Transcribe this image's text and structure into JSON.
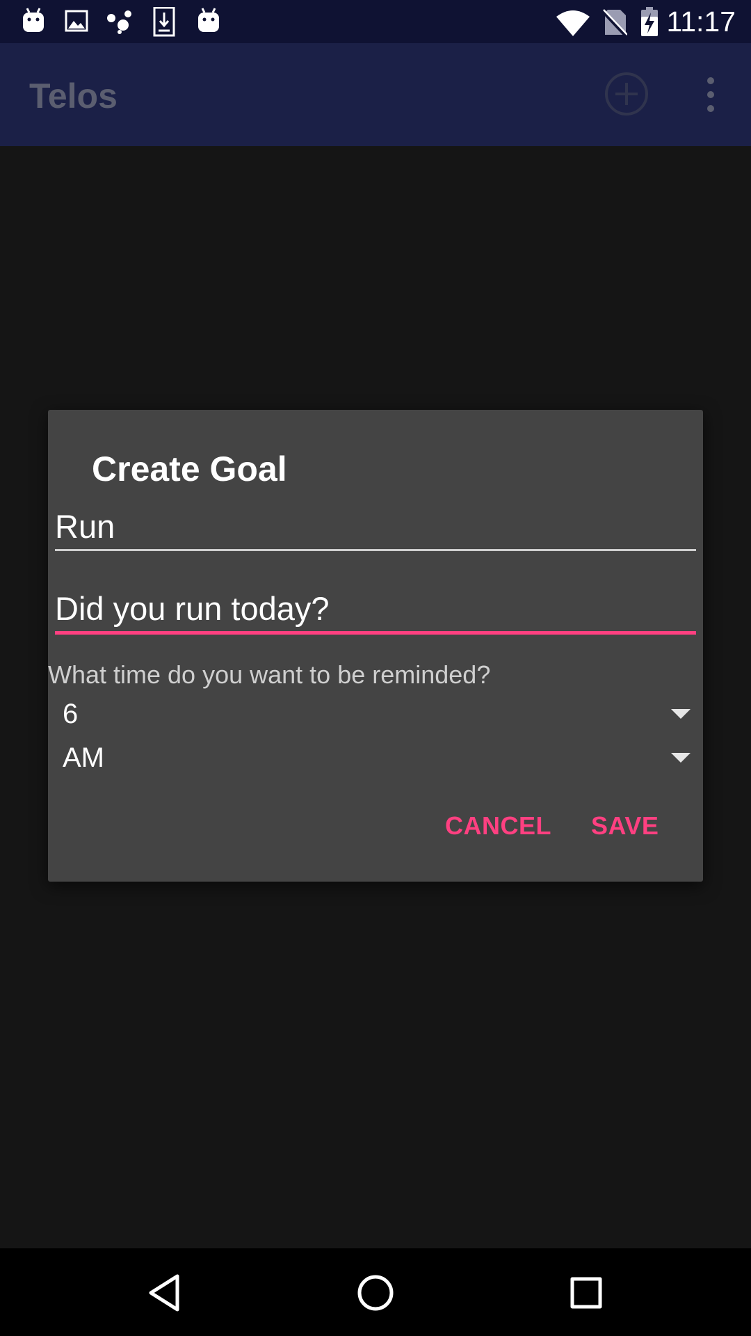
{
  "status_bar": {
    "time": "11:17",
    "icons": [
      "android-icon",
      "image-icon",
      "assistant-icon",
      "download-icon",
      "android-icon",
      "wifi-icon",
      "no-sim-icon",
      "battery-charging-icon"
    ]
  },
  "app_bar": {
    "title": "Telos",
    "actions": [
      "add-circle-icon",
      "more-vert-icon"
    ],
    "background": "#1b2047"
  },
  "dialog": {
    "title": "Create Goal",
    "goal_field": {
      "value": "Run"
    },
    "question_field": {
      "value": "Did you run today?"
    },
    "reminder_label": "What time do you want to be reminded?",
    "hour_spinner": {
      "selected": "6"
    },
    "ampm_spinner": {
      "selected": "AM"
    },
    "buttons": {
      "cancel_label": "CANCEL",
      "save_label": "SAVE"
    },
    "accent_color": "#ff4081"
  },
  "nav_bar": {
    "buttons": [
      "back-icon",
      "home-icon",
      "recents-icon"
    ]
  }
}
